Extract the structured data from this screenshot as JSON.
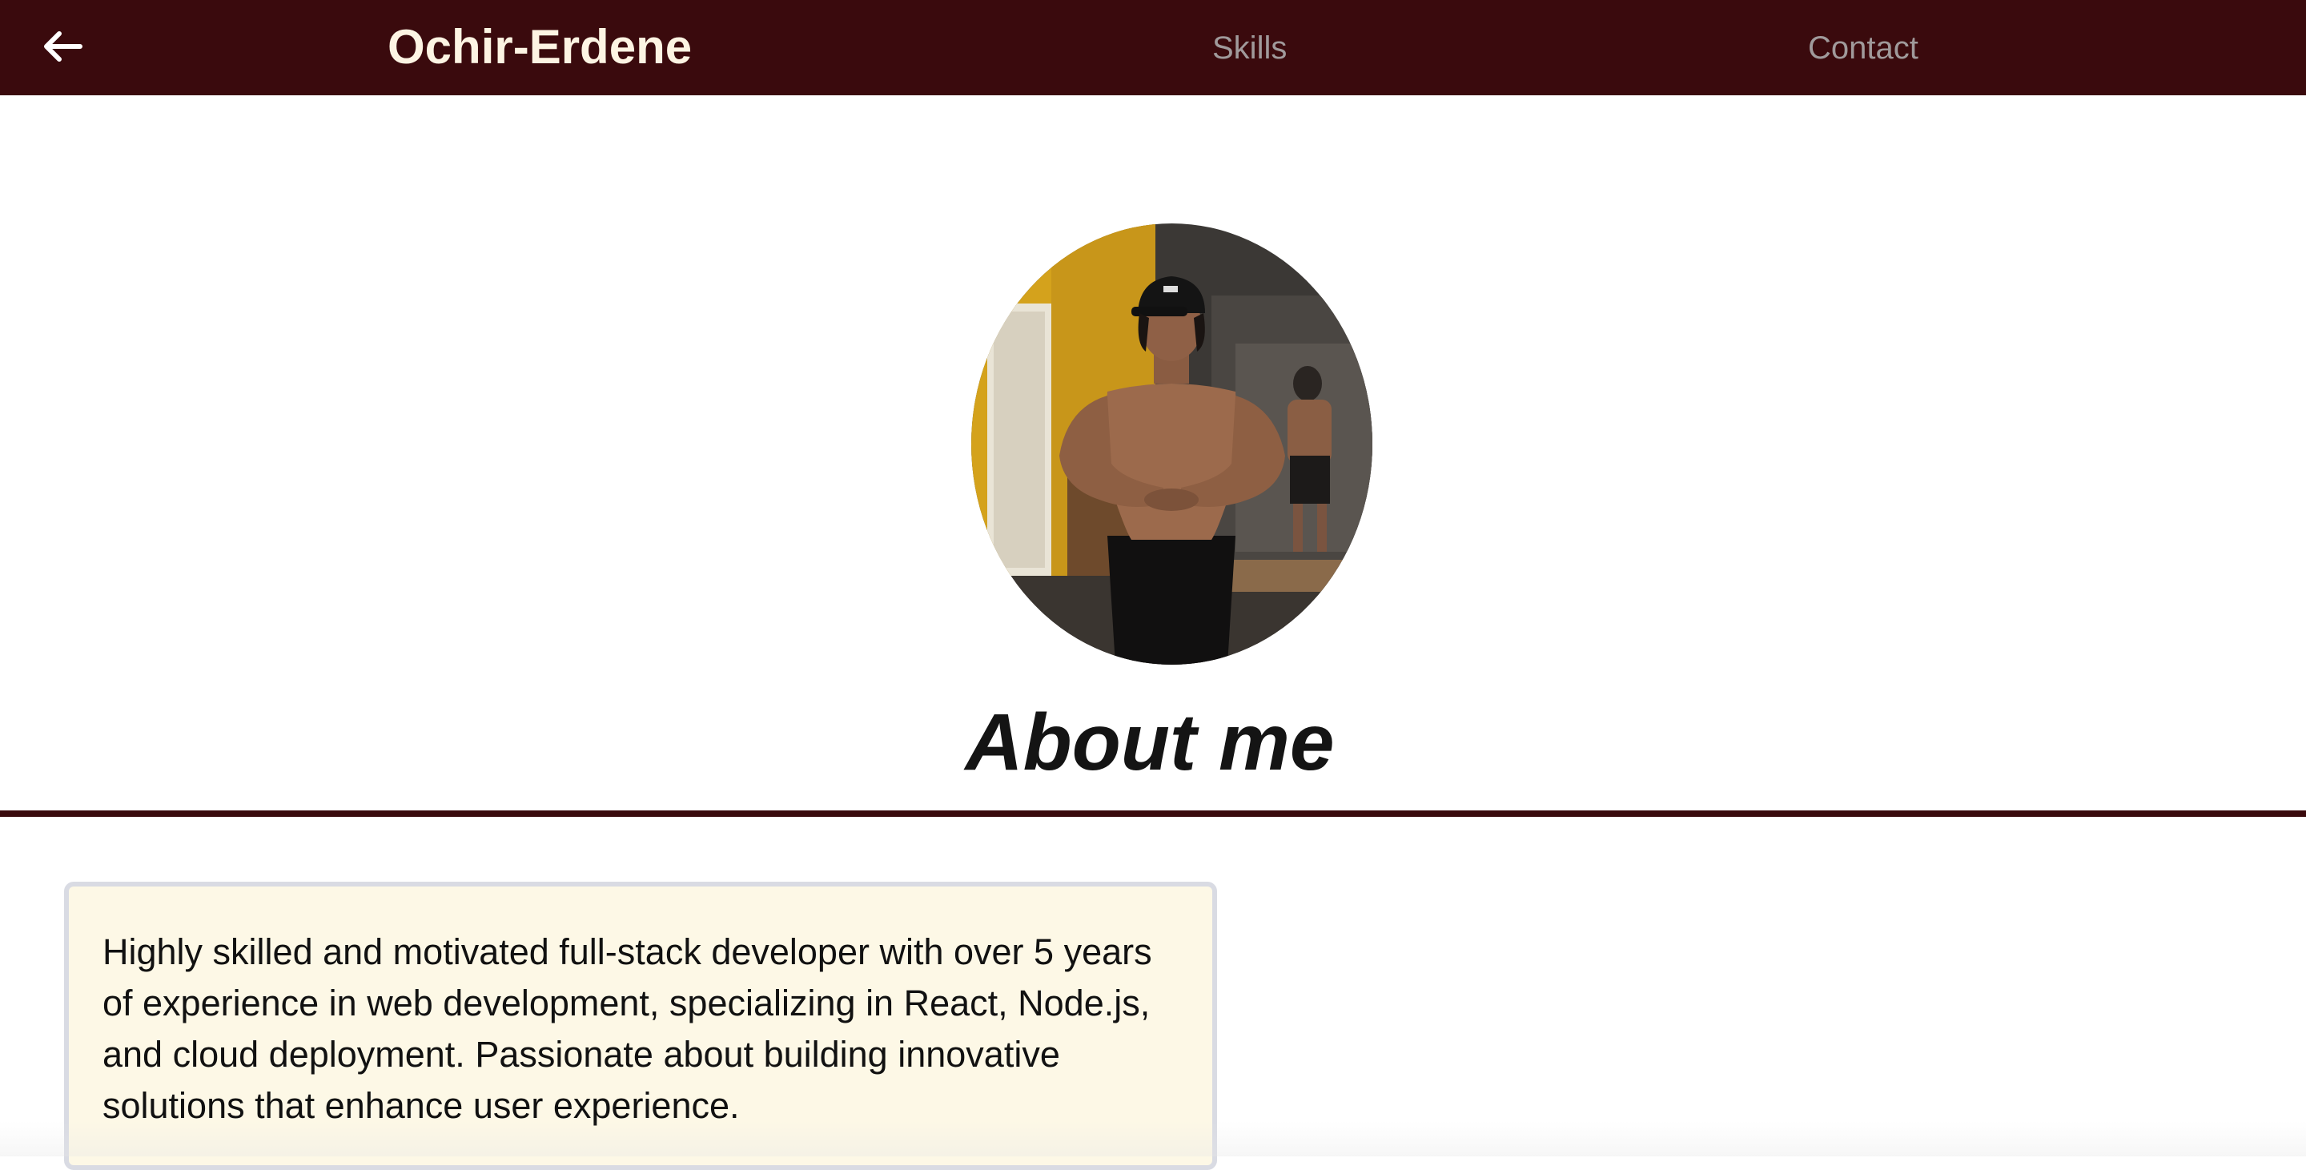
{
  "header": {
    "back_icon": "arrow-left-icon",
    "brand": "Ochir-Erdene",
    "nav": [
      {
        "label": "Skills"
      },
      {
        "label": "Contact"
      }
    ]
  },
  "profile": {
    "photo_alt": "Profile photo"
  },
  "about": {
    "title": "About me",
    "bio": "Highly skilled and motivated full-stack developer with over 5 years of experience in web development, specializing in React, Node.js, and cloud deployment. Passionate about building innovative solutions that enhance user experience."
  },
  "colors": {
    "nav_bg": "#3a0a0d",
    "brand_text": "#fdf4e3",
    "nav_link": "#a09a9b",
    "card_bg": "#fdf8e6",
    "card_border": "#d9dbe3"
  }
}
